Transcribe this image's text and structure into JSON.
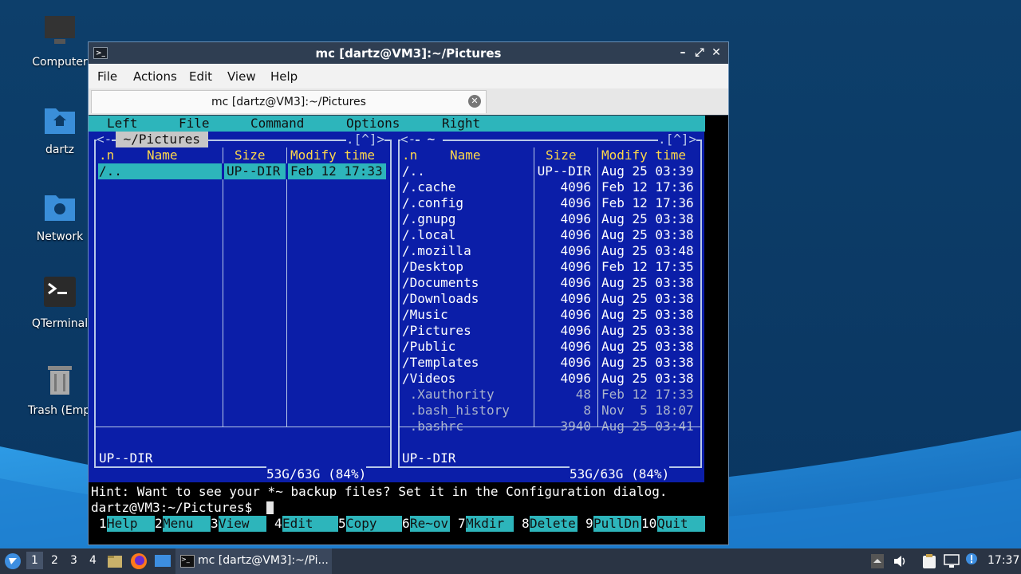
{
  "desktop": {
    "icons": [
      {
        "label": "Computer",
        "icon": "computer-icon"
      },
      {
        "label": "dartz",
        "icon": "home-folder-icon"
      },
      {
        "label": "Network",
        "icon": "network-folder-icon"
      },
      {
        "label": "QTerminal",
        "icon": "terminal-icon"
      },
      {
        "label": "Trash (Empt",
        "icon": "trash-icon"
      }
    ]
  },
  "window": {
    "title": "mc [dartz@VM3]:~/Pictures",
    "menu": [
      "File",
      "Actions",
      "Edit",
      "View",
      "Help"
    ],
    "tab_title": "mc [dartz@VM3]:~/Pictures"
  },
  "mc": {
    "top_menu": [
      "Left",
      "File",
      "Command",
      "Options",
      "Right"
    ],
    "left_panel": {
      "frame_left": "<-",
      "path": " ~/Pictures ",
      "frame_right": ".[^]>",
      "headers": {
        "n": ".n",
        "name": "Name",
        "size": "Size",
        "time": "Modify time"
      },
      "rows": [
        {
          "name": "/..",
          "size": "UP--DIR",
          "time": "Feb 12 17:33",
          "selected": true
        }
      ],
      "status": "UP--DIR",
      "disk": "53G/63G (84%)"
    },
    "right_panel": {
      "frame_left": "<-",
      "path": " ~ ",
      "frame_right": ".[^]>",
      "headers": {
        "n": ".n",
        "name": "Name",
        "size": "Size",
        "time": "Modify time"
      },
      "rows": [
        {
          "name": "/..",
          "size": "UP--DIR",
          "time": "Aug 25 03:39"
        },
        {
          "name": "/.cache",
          "size": "4096",
          "time": "Feb 12 17:36"
        },
        {
          "name": "/.config",
          "size": "4096",
          "time": "Feb 12 17:36"
        },
        {
          "name": "/.gnupg",
          "size": "4096",
          "time": "Aug 25 03:38"
        },
        {
          "name": "/.local",
          "size": "4096",
          "time": "Aug 25 03:38"
        },
        {
          "name": "/.mozilla",
          "size": "4096",
          "time": "Aug 25 03:48"
        },
        {
          "name": "/Desktop",
          "size": "4096",
          "time": "Feb 12 17:35"
        },
        {
          "name": "/Documents",
          "size": "4096",
          "time": "Aug 25 03:38"
        },
        {
          "name": "/Downloads",
          "size": "4096",
          "time": "Aug 25 03:38"
        },
        {
          "name": "/Music",
          "size": "4096",
          "time": "Aug 25 03:38"
        },
        {
          "name": "/Pictures",
          "size": "4096",
          "time": "Aug 25 03:38"
        },
        {
          "name": "/Public",
          "size": "4096",
          "time": "Aug 25 03:38"
        },
        {
          "name": "/Templates",
          "size": "4096",
          "time": "Aug 25 03:38"
        },
        {
          "name": "/Videos",
          "size": "4096",
          "time": "Aug 25 03:38"
        },
        {
          "name": " .Xauthority",
          "size": "48",
          "time": "Feb 12 17:33",
          "dim": true
        },
        {
          "name": " .bash_history",
          "size": "8",
          "time": "Nov  5 18:07",
          "dim": true
        },
        {
          "name": " .bashrc",
          "size": "3940",
          "time": "Aug 25 03:41",
          "dim": true
        }
      ],
      "status": "UP--DIR",
      "disk": "53G/63G (84%)"
    },
    "hint": "Hint: Want to see your *~ backup files? Set it in the Configuration dialog.",
    "prompt": "dartz@VM3:~/Pictures$ ",
    "fkeys": [
      {
        "n": "1",
        "label": "Help"
      },
      {
        "n": "2",
        "label": "Menu"
      },
      {
        "n": "3",
        "label": "View"
      },
      {
        "n": "4",
        "label": "Edit"
      },
      {
        "n": "5",
        "label": "Copy"
      },
      {
        "n": "6",
        "label": "Re~ov"
      },
      {
        "n": "7",
        "label": "Mkdir"
      },
      {
        "n": "8",
        "label": "Delete"
      },
      {
        "n": "9",
        "label": "PullDn"
      },
      {
        "n": "10",
        "label": "Quit"
      }
    ]
  },
  "taskbar": {
    "workspaces": [
      "1",
      "2",
      "3",
      "4"
    ],
    "active_workspace": "1",
    "task_label": "mc [dartz@VM3]:~/Pi...",
    "clock": "17:37"
  },
  "colors": {
    "mc_blue": "#0b1ea8",
    "mc_cyan": "#2db5bb",
    "mc_yellow": "#ffd84a",
    "desktop_blue": "#0b3d66",
    "taskbar": "#2a3444"
  }
}
